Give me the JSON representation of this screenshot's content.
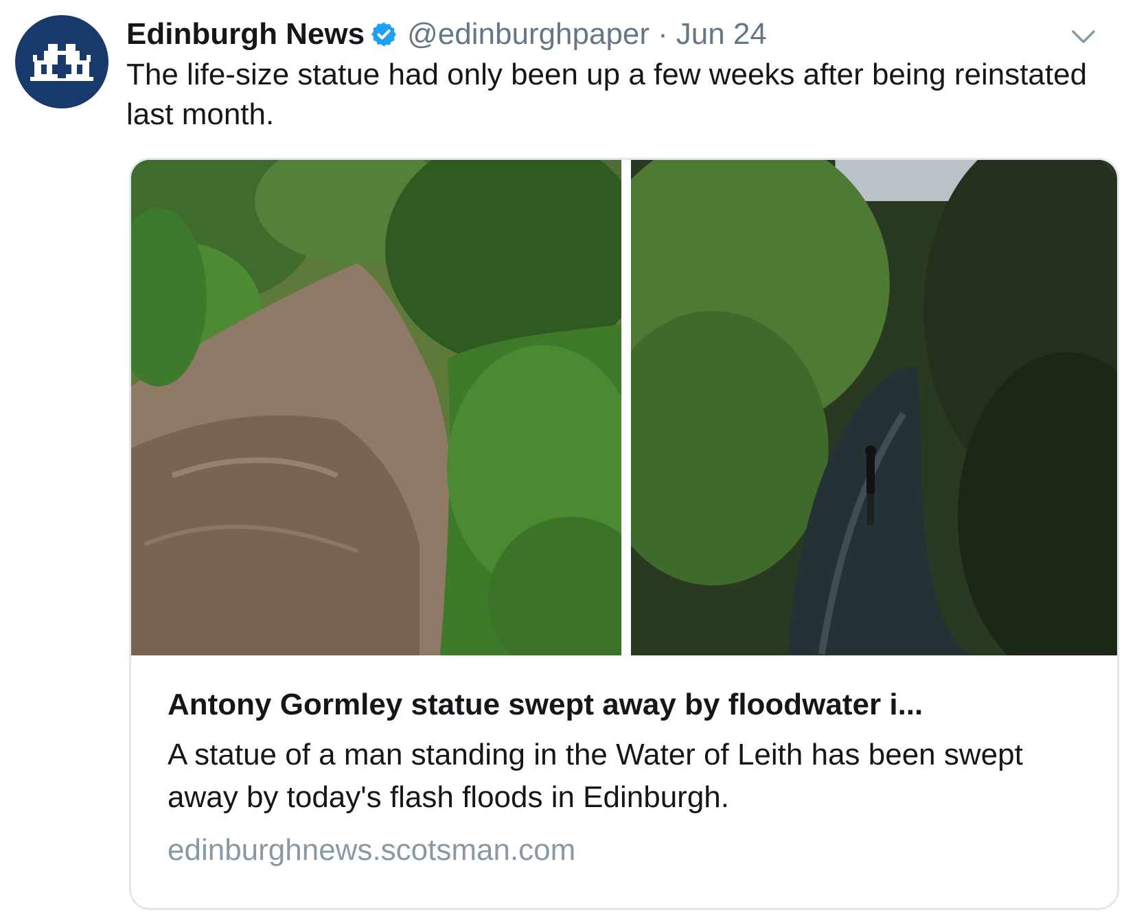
{
  "account": {
    "name": "Edinburgh News",
    "handle": "@edinburghpaper",
    "separator": "·",
    "date": "Jun 24"
  },
  "icons": {
    "avatar": "castle-logo-icon",
    "verified": "verified-badge-icon",
    "menu": "chevron-down-icon"
  },
  "tweet": {
    "text": "The life-size statue had only been up a few weeks after being reinstated last month."
  },
  "card": {
    "title": "Antony Gormley statue swept away by floodwater i...",
    "description": "A statue of a man standing in the Water of Leith has been swept away by today's flash floods in Edinburgh.",
    "domain": "edinburghnews.scotsman.com"
  },
  "colors": {
    "avatar_bg": "#183a6a",
    "verified": "#1da1f2",
    "secondary_text": "#657786",
    "card_border": "#e1e8ed"
  }
}
